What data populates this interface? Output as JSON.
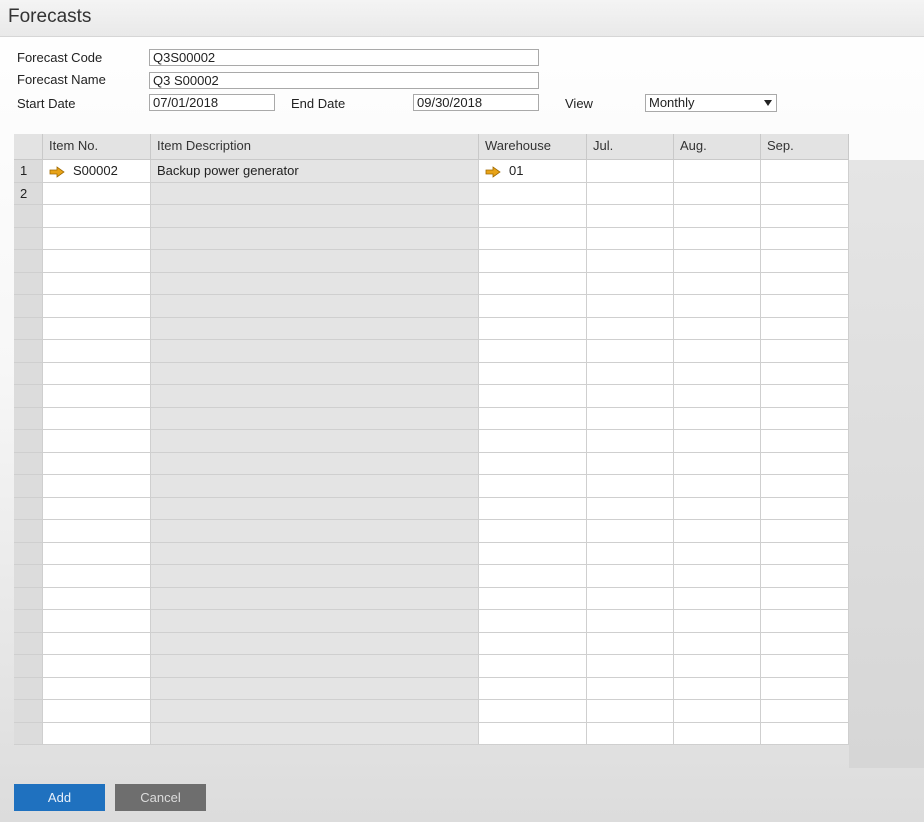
{
  "window": {
    "title": "Forecasts"
  },
  "form": {
    "code_label": "Forecast Code",
    "code_value": "Q3S00002",
    "name_label": "Forecast Name",
    "name_value": "Q3 S00002",
    "start_label": "Start Date",
    "start_value": "07/01/2018",
    "end_label": "End Date",
    "end_value": "09/30/2018",
    "view_label": "View",
    "view_value": "Monthly"
  },
  "table": {
    "columns": [
      "",
      "Item No.",
      "Item Description",
      "Warehouse",
      "Jul.",
      "Aug.",
      "Sep."
    ],
    "rows": [
      {
        "num": "1",
        "item_no": "S00002",
        "description": "Backup power generator",
        "warehouse": "01",
        "jul": "",
        "aug": "",
        "sep": ""
      },
      {
        "num": "2",
        "item_no": "",
        "description": "",
        "warehouse": "",
        "jul": "",
        "aug": "",
        "sep": ""
      }
    ],
    "empty_row_count": 24
  },
  "buttons": {
    "add": "Add",
    "cancel": "Cancel"
  },
  "colors": {
    "add_button": "#1f71bf",
    "cancel_button": "#6e6e6e",
    "link_arrow": "#e8a317"
  },
  "icons": {
    "link_arrow": "link-arrow-icon",
    "dropdown": "chevron-down-icon"
  }
}
